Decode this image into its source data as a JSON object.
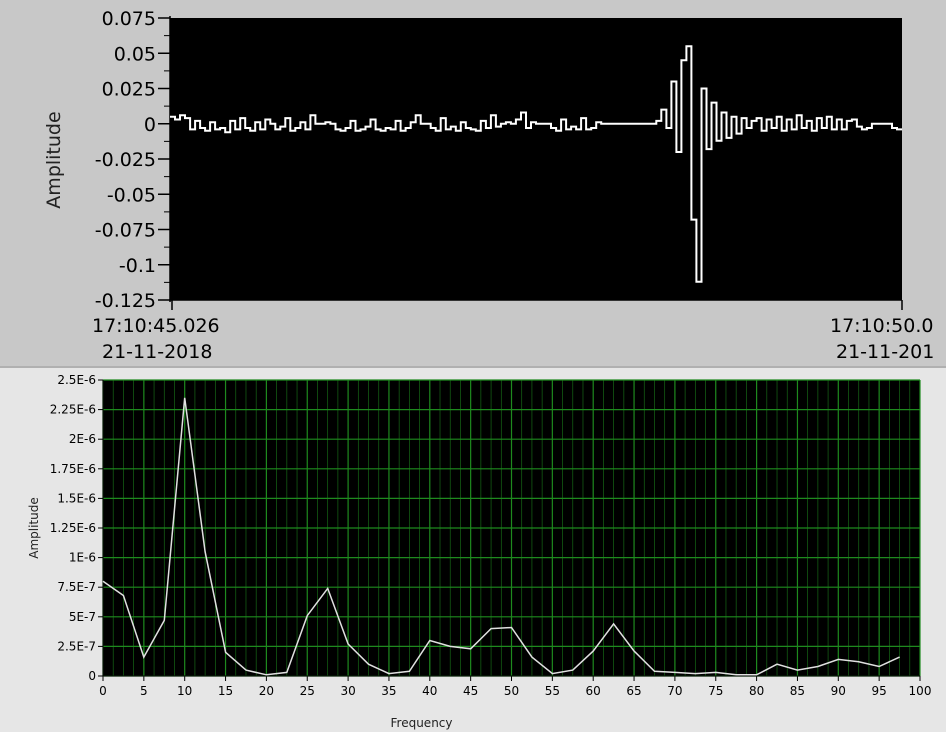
{
  "chart_data": [
    {
      "type": "line",
      "ylabel": "Amplitude",
      "ylim": [
        -0.125,
        0.075
      ],
      "y_ticks": [
        "0.075",
        "0.05",
        "0.025",
        "0",
        "-0.025",
        "-0.05",
        "-0.075",
        "-0.1",
        "-0.125"
      ],
      "x_ticks": [
        {
          "time": "17:10:45.026",
          "date": "21-11-2018"
        },
        {
          "time": "17:10:50.0",
          "date": "21-11-201"
        }
      ],
      "background": "#000000",
      "line_color": "#ffffff",
      "grid": false,
      "series": [
        {
          "values": [
            0.005,
            0.003,
            0.006,
            0.004,
            -0.004,
            0.002,
            -0.003,
            -0.005,
            0.001,
            -0.004,
            -0.003,
            -0.006,
            0.002,
            -0.004,
            0.004,
            -0.003,
            -0.005,
            0.001,
            -0.004,
            0.003,
            0.0,
            -0.004,
            -0.002,
            0.004,
            -0.005,
            -0.003,
            0.001,
            -0.004,
            0.006,
            0.0,
            0.0,
            0.001,
            0.0,
            -0.004,
            -0.005,
            -0.003,
            0.002,
            -0.005,
            -0.004,
            -0.002,
            0.003,
            -0.004,
            -0.005,
            -0.003,
            -0.004,
            0.002,
            -0.005,
            -0.003,
            0.001,
            0.006,
            0.0,
            0.0,
            -0.003,
            -0.005,
            0.004,
            -0.004,
            -0.002,
            -0.005,
            0.001,
            -0.003,
            -0.004,
            -0.005,
            0.002,
            -0.003,
            0.006,
            -0.002,
            0.0,
            0.001,
            0.0,
            0.003,
            0.008,
            -0.003,
            0.001,
            0.0,
            0.0,
            0.0,
            -0.003,
            -0.005,
            0.003,
            -0.004,
            -0.002,
            -0.004,
            0.004,
            -0.004,
            -0.003,
            0.001,
            0.0,
            0.0,
            0.0,
            0.0,
            0.0,
            0.0,
            0.0,
            0.0,
            0.0,
            0.0,
            0.0,
            0.002,
            0.01,
            -0.003,
            0.03,
            -0.02,
            0.045,
            0.055,
            -0.068,
            -0.112,
            0.025,
            -0.018,
            0.015,
            -0.012,
            0.008,
            -0.01,
            0.005,
            -0.007,
            0.004,
            -0.003,
            0.002,
            0.004,
            -0.005,
            0.003,
            -0.003,
            0.005,
            -0.005,
            0.003,
            -0.004,
            0.006,
            -0.003,
            0.002,
            -0.005,
            0.004,
            -0.003,
            0.005,
            -0.004,
            0.003,
            -0.004,
            0.002,
            0.003,
            -0.002,
            -0.004,
            -0.003,
            0.0,
            0.0,
            0.0,
            0.0,
            -0.003,
            -0.004
          ]
        }
      ]
    },
    {
      "type": "line",
      "xlabel": "Frequency",
      "ylabel": "Amplitude",
      "xlim": [
        0,
        100
      ],
      "ylim": [
        0,
        2.5e-06
      ],
      "x_ticks": [
        "0",
        "5",
        "10",
        "15",
        "20",
        "25",
        "30",
        "35",
        "40",
        "45",
        "50",
        "55",
        "60",
        "65",
        "70",
        "75",
        "80",
        "85",
        "90",
        "95",
        "100"
      ],
      "y_ticks": [
        "2.5E-6",
        "2.25E-6",
        "2E-6",
        "1.75E-6",
        "1.5E-6",
        "1.25E-6",
        "1E-6",
        "7.5E-7",
        "5E-7",
        "2.5E-7",
        "0"
      ],
      "background": "#000000",
      "grid_color": "#1e8a1e",
      "line_color": "#e0e0e0",
      "grid": true,
      "series": [
        {
          "x": [
            0,
            2.5,
            5,
            7.5,
            10,
            12.5,
            15,
            17.5,
            20,
            22.5,
            25,
            27.5,
            30,
            32.5,
            35,
            37.5,
            40,
            42.5,
            45,
            47.5,
            50,
            52.5,
            55,
            57.5,
            60,
            62.5,
            65,
            67.5,
            70,
            72.5,
            75,
            77.5,
            80,
            82.5,
            85,
            87.5,
            90,
            92.5,
            95,
            97.5
          ],
          "values": [
            8e-07,
            6.8e-07,
            1.6e-07,
            4.7e-07,
            2.35e-06,
            1.05e-06,
            2e-07,
            5e-08,
            1e-08,
            3e-08,
            5.1e-07,
            7.4e-07,
            2.7e-07,
            1e-07,
            2e-08,
            4e-08,
            3e-07,
            2.5e-07,
            2.3e-07,
            4e-07,
            4.1e-07,
            1.6e-07,
            2e-08,
            5e-08,
            2.1e-07,
            4.4e-07,
            2.1e-07,
            4e-08,
            3e-08,
            2e-08,
            3e-08,
            1e-08,
            1e-08,
            1e-07,
            5e-08,
            8e-08,
            1.4e-07,
            1.2e-07,
            8e-08,
            1.6e-07
          ]
        }
      ]
    }
  ]
}
